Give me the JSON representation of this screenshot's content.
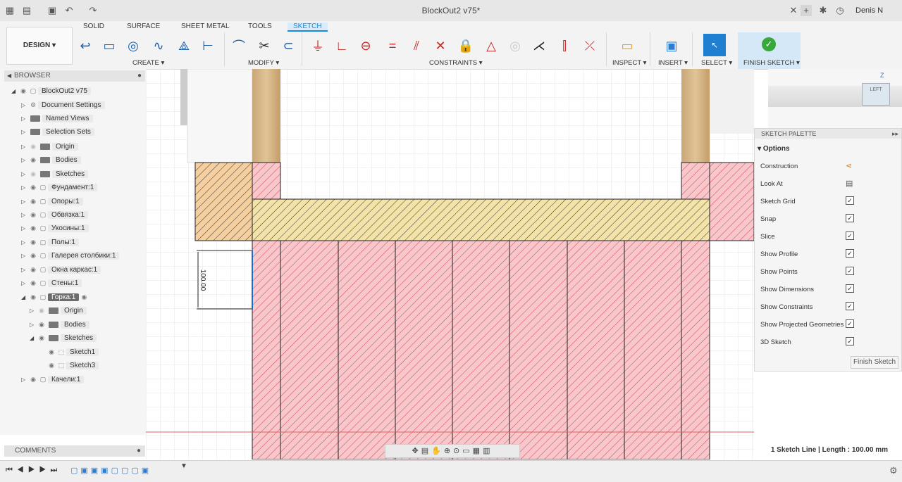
{
  "app": {
    "doc_title": "BlockOut2 v75*",
    "user": "Denis N"
  },
  "toolbar": {
    "tabs": [
      "SOLID",
      "SURFACE",
      "SHEET METAL",
      "TOOLS",
      "SKETCH"
    ],
    "design": "DESIGN ▾",
    "groups": {
      "create": "CREATE ▾",
      "modify": "MODIFY ▾",
      "constraints": "CONSTRAINTS ▾",
      "inspect": "INSPECT ▾",
      "insert": "INSERT ▾",
      "select": "SELECT ▾",
      "finish": "FINISH SKETCH ▾"
    }
  },
  "browser": {
    "header": "BROWSER",
    "items": [
      "BlockOut2 v75",
      "Document Settings",
      "Named Views",
      "Selection Sets",
      "Origin",
      "Bodies",
      "Sketches",
      "Фундамент:1",
      "Опоры:1",
      "Обвязка:1",
      "Укосины:1",
      "Полы:1",
      "Галерея столбики:1",
      "Окна каркас:1",
      "Стены:1",
      "Горка:1",
      "Origin",
      "Bodies",
      "Sketches",
      "Sketch1",
      "Sketch3",
      "Качели:1"
    ]
  },
  "palette": {
    "title": "SKETCH PALETTE",
    "section": "Options",
    "rows": [
      "Construction",
      "Look At",
      "Sketch Grid",
      "Snap",
      "Slice",
      "Show Profile",
      "Show Points",
      "Show Dimensions",
      "Show Constraints",
      "Show Projected Geometries",
      "3D Sketch"
    ],
    "finish": "Finish Sketch"
  },
  "canvas": {
    "dimension": "100.00",
    "viewcube": "LEFT"
  },
  "comments": "COMMENTS",
  "status": "1 Sketch Line | Length : 100.00 mm",
  "colors": {
    "accent": "#1c88d8",
    "hatch_red": "#f7c7cc",
    "hatch_yellow": "#f4e3a8",
    "hatch_orange": "#f6cfa0"
  }
}
